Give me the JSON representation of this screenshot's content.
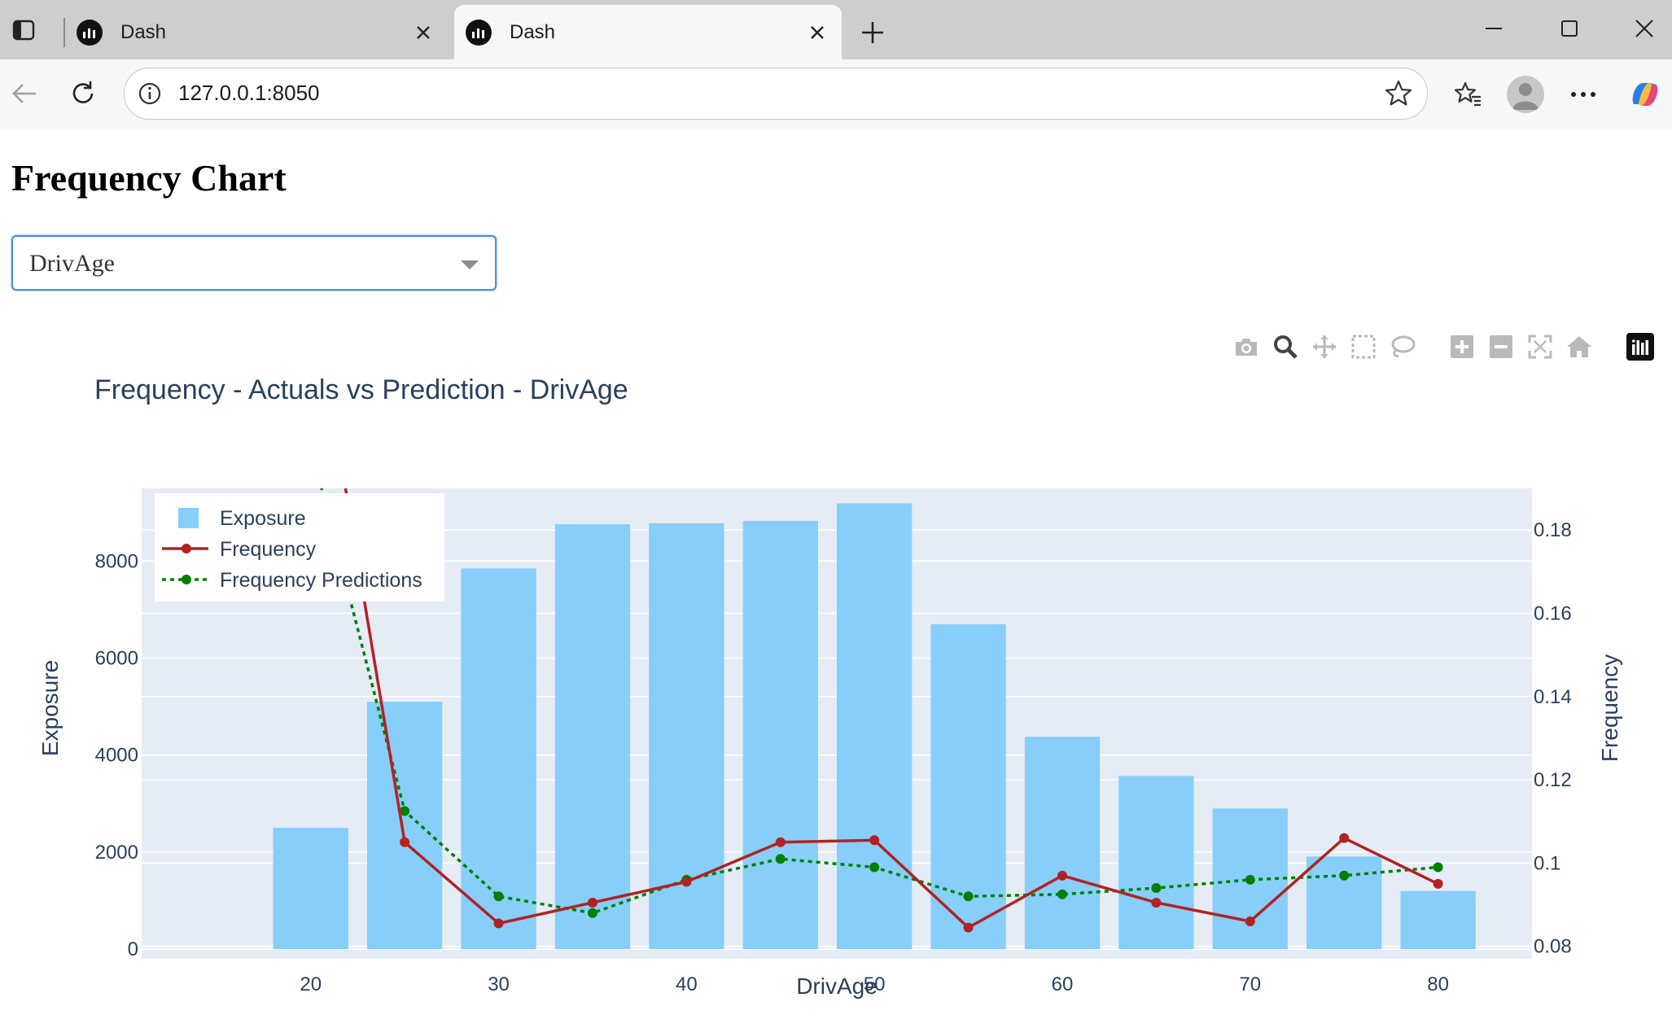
{
  "browser": {
    "tabs": [
      {
        "title": "Dash",
        "active": false
      },
      {
        "title": "Dash",
        "active": true
      }
    ],
    "url": "127.0.0.1:8050"
  },
  "page": {
    "heading": "Frequency Chart",
    "dropdown": {
      "selected": "DrivAge"
    }
  },
  "modebar": {
    "icons": [
      "camera-icon",
      "zoom-icon",
      "pan-icon",
      "box-select-icon",
      "lasso-icon",
      "zoom-in-icon",
      "zoom-out-icon",
      "autoscale-icon",
      "reset-axes-icon",
      "plotly-logo"
    ]
  },
  "colors": {
    "bar": "#87cefa",
    "frequency": "#b22222",
    "prediction": "#008000",
    "plot_bg": "#e5ecf6",
    "text": "#2a3f5f"
  },
  "chart_data": {
    "type": "bar",
    "title": "Frequency - Actuals vs Prediction - DrivAge",
    "xlabel": "DrivAge",
    "ylabel": "Exposure",
    "y2label": "Frequency",
    "x": [
      20,
      25,
      30,
      35,
      40,
      45,
      50,
      55,
      60,
      65,
      70,
      75,
      80
    ],
    "xticks": [
      20,
      30,
      40,
      50,
      60,
      70,
      80
    ],
    "yticks": [
      0,
      2000,
      4000,
      6000,
      8000
    ],
    "y2ticks": [
      0.08,
      0.1,
      0.12,
      0.14,
      0.16,
      0.18
    ],
    "y2ticklabels": [
      "0.08",
      "0.1",
      "0.12",
      "0.14",
      "0.16",
      "0.18"
    ],
    "ylim": [
      -200,
      9500
    ],
    "y2lim": [
      0.077,
      0.19
    ],
    "grid": true,
    "legend_position": "top-left",
    "series": [
      {
        "name": "Exposure",
        "kind": "bar",
        "axis": "y",
        "values": [
          2500,
          5100,
          7850,
          8760,
          8780,
          8830,
          9190,
          6700,
          4380,
          3570,
          2900,
          1910,
          1200
        ]
      },
      {
        "name": "Frequency",
        "kind": "line+markers",
        "axis": "y2",
        "values": [
          0.24,
          0.105,
          0.0855,
          0.0905,
          0.0955,
          0.105,
          0.1055,
          0.0845,
          0.097,
          0.0905,
          0.086,
          0.106,
          0.095
        ]
      },
      {
        "name": "Frequency Predictions",
        "kind": "dotted-line+markers",
        "axis": "y2",
        "values": [
          0.2,
          0.1125,
          0.092,
          0.088,
          0.096,
          0.101,
          0.099,
          0.092,
          0.0925,
          0.094,
          0.096,
          0.097,
          0.099
        ]
      }
    ]
  }
}
